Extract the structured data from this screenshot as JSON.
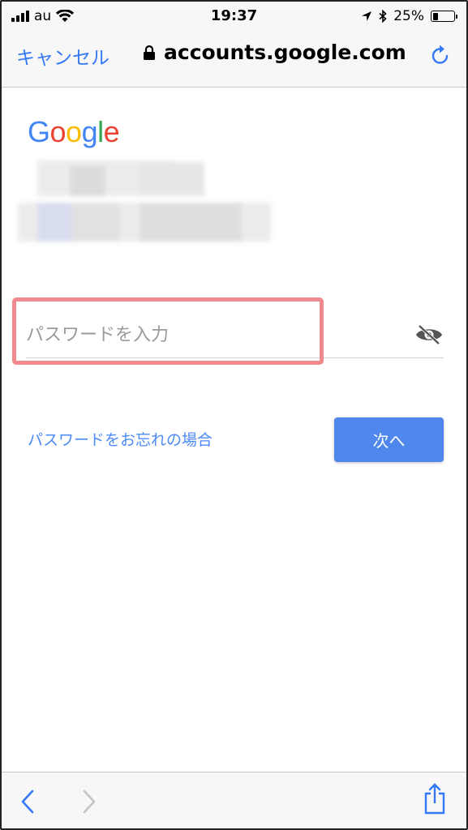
{
  "status_bar": {
    "carrier": "au",
    "time": "19:37",
    "battery_percent": "25%",
    "battery_level": 0.25,
    "icons": [
      "signal-icon",
      "wifi-icon",
      "location-icon",
      "bluetooth-icon",
      "battery-icon"
    ]
  },
  "navbar": {
    "cancel_label": "キャンセル",
    "url": "accounts.google.com",
    "icons": [
      "lock-icon",
      "reload-icon"
    ]
  },
  "logo": {
    "letters": [
      "G",
      "o",
      "o",
      "g",
      "l",
      "e"
    ],
    "colors": [
      "#4285f4",
      "#ea4335",
      "#fbbc05",
      "#4285f4",
      "#34a853",
      "#ea4335"
    ]
  },
  "password": {
    "placeholder": "パスワードを入力",
    "value": "",
    "toggle_icon": "eye-off-icon"
  },
  "forgot_link": "パスワードをお忘れの場合",
  "next_button": "次へ",
  "colors": {
    "accent": "#3478f6",
    "button": "#5087ec",
    "highlight": "#f08a8e"
  },
  "toolbar": {
    "icons": [
      "back-icon",
      "forward-icon",
      "share-icon"
    ]
  }
}
